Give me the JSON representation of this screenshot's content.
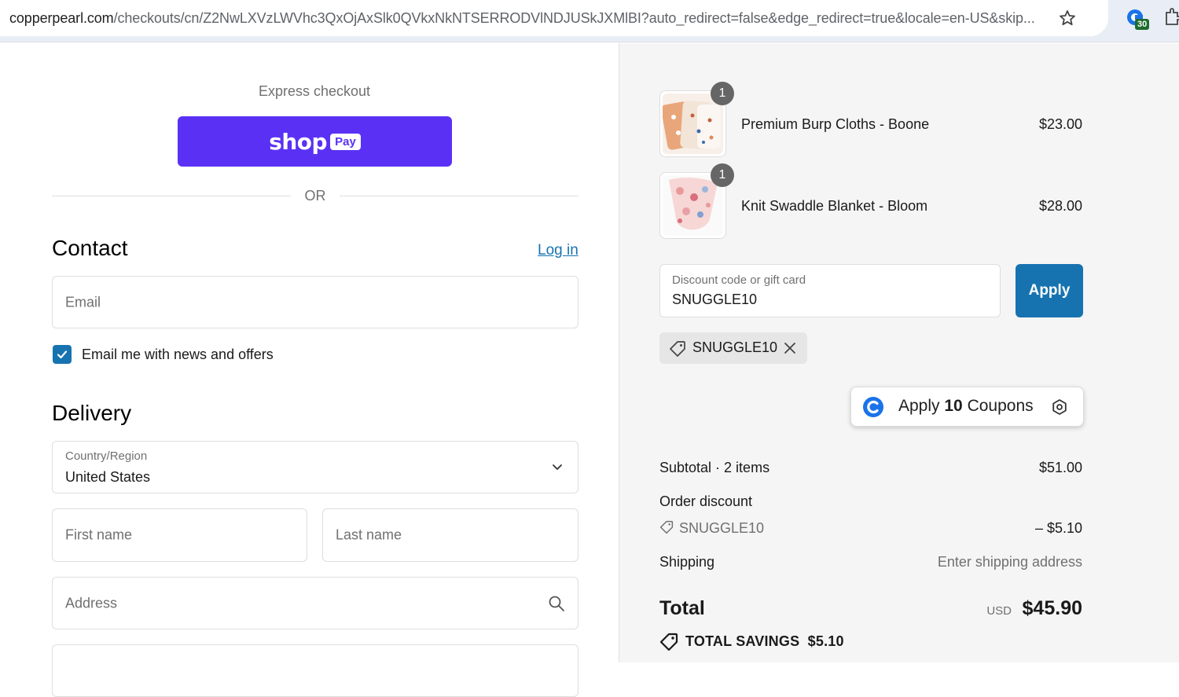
{
  "browser": {
    "url_domain": "copperpearl.com",
    "url_path": "/checkouts/cn/Z2NwLXVzLWVhc3QxOjAxSlk0QVkxNkNTSERRODVlNDJUSkJXMlBI?auto_redirect=false&edge_redirect=true&locale=en-US&skip...",
    "extension_badge": "30",
    "icons": [
      "site-info-icon",
      "bookmark-star-icon",
      "extension-icon",
      "puzzle-icon"
    ]
  },
  "checkout": {
    "express_label": "Express checkout",
    "shop_word": "shop",
    "pay_word": "Pay",
    "or_text": "OR",
    "contact": {
      "title": "Contact",
      "login": "Log in",
      "email_placeholder": "Email",
      "newsletter_label": "Email me with news and offers",
      "newsletter_checked": true
    },
    "delivery": {
      "title": "Delivery",
      "country_label": "Country/Region",
      "country_value": "United States",
      "first_name_placeholder": "First name",
      "last_name_placeholder": "Last name",
      "address_placeholder": "Address"
    }
  },
  "summary": {
    "items": [
      {
        "name": "Premium Burp Cloths - Boone",
        "price": "$23.00",
        "qty": "1"
      },
      {
        "name": "Knit Swaddle Blanket - Bloom",
        "price": "$28.00",
        "qty": "1"
      }
    ],
    "discount": {
      "label": "Discount code or gift card",
      "value": "SNUGGLE10",
      "apply": "Apply",
      "applied_code": "SNUGGLE10"
    },
    "coupon_ext": {
      "prefix": "Apply",
      "bold": "10",
      "suffix": "Coupons"
    },
    "subtotal_label": "Subtotal · 2 items",
    "subtotal_value": "$51.00",
    "order_discount_label": "Order discount",
    "order_discount_code": "SNUGGLE10",
    "order_discount_value": "– $5.10",
    "shipping_label": "Shipping",
    "shipping_value": "Enter shipping address",
    "total_label": "Total",
    "total_currency": "USD",
    "total_value": "$45.90",
    "savings_label": "TOTAL SAVINGS  $5.10"
  },
  "colors": {
    "shop_pay": "#5a31f4",
    "accent": "#1773b0",
    "summary_bg": "#f5f5f5"
  }
}
